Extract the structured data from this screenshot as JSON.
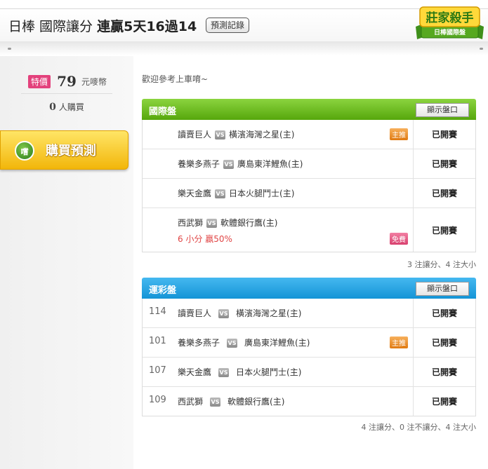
{
  "header": {
    "title_prefix": "日棒 國際讓分",
    "record": "連贏5天16過14",
    "record_button": "預測記錄",
    "logo_line1": "莊家殺手",
    "logo_line2": "日棒國際盤"
  },
  "sidebar": {
    "price_tag": "特價",
    "price": "79",
    "price_unit": "元嘜幣",
    "buyers_count": "0",
    "buyers_label": "人購買",
    "buy_badge": "嚐",
    "buy_button": "購買預測"
  },
  "welcome": "歡迎參考上車唷~",
  "intl": {
    "title": "國際盤",
    "button": "顯示盤口",
    "rows": [
      {
        "away": "讀賣巨人",
        "vs": "VS",
        "home": "橫濱海灣之星(主)",
        "tag": "主推",
        "status": "已開賽"
      },
      {
        "away": "養樂多燕子",
        "vs": "VS",
        "home": "廣島東洋鯉魚(主)",
        "status": "已開賽"
      },
      {
        "away": "樂天金鷹",
        "vs": "VS",
        "home": "日本火腿鬥士(主)",
        "status": "已開賽"
      },
      {
        "away": "西武獅",
        "vs": "VS",
        "home": "軟體銀行鷹(主)",
        "result": "6 小分 贏50%",
        "tag": "免費",
        "status": "已開賽"
      }
    ],
    "note": "3 注讓分、4 注大小"
  },
  "lottery": {
    "title": "運彩盤",
    "button": "顯示盤口",
    "rows": [
      {
        "num": "114",
        "away": "讀賣巨人",
        "vs": "VS",
        "home": "橫濱海灣之星(主)",
        "status": "已開賽"
      },
      {
        "num": "101",
        "away": "養樂多燕子",
        "vs": "VS",
        "home": "廣島東洋鯉魚(主)",
        "tag": "主推",
        "status": "已開賽"
      },
      {
        "num": "107",
        "away": "樂天金鷹",
        "vs": "VS",
        "home": "日本火腿鬥士(主)",
        "status": "已開賽"
      },
      {
        "num": "109",
        "away": "西武獅",
        "vs": "VS",
        "home": "軟體銀行鷹(主)",
        "status": "已開賽"
      }
    ],
    "note": "4 注讓分、0 注不讓分、4 注大小"
  },
  "colors": {
    "intl_header": "#6cbd20",
    "lottery_header": "#1ea3e3",
    "tag_main": "#ee8f2a",
    "tag_free": "#e2507c",
    "result_text": "#e04545"
  }
}
